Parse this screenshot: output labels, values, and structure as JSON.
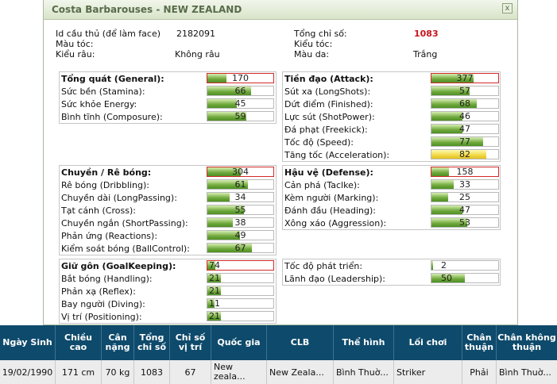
{
  "window": {
    "title": "Costa Barbarouses - NEW ZEALAND",
    "close_label": "x"
  },
  "info": {
    "id_label": "Id cầu thủ (để làm face)",
    "id_value": "2182091",
    "hair_color_label": "Màu tóc:",
    "beard_label": "Kiểu râu:",
    "beard_value": "Không râu",
    "total_label": "Tổng chỉ số:",
    "total_value": "1083",
    "hair_style_label": "Kiểu tóc:",
    "skin_label": "Màu da:",
    "skin_value": "Trắng"
  },
  "panels": {
    "general": {
      "header": "Tổng quát (General):",
      "header_value": 170,
      "items": [
        {
          "label": "Sức bền (Stamina):",
          "value": 66
        },
        {
          "label": "Sức khỏe Energy:",
          "value": 45
        },
        {
          "label": "Bình tĩnh (Composure):",
          "value": 59
        }
      ]
    },
    "attack": {
      "header": "Tiền đạo (Attack):",
      "header_value": 377,
      "items": [
        {
          "label": "Sút xa (LongShots):",
          "value": 57
        },
        {
          "label": "Dứt điểm (Finished):",
          "value": 68
        },
        {
          "label": "Lực sút (ShotPower):",
          "value": 46
        },
        {
          "label": "Đá phạt (Freekick):",
          "value": 47
        },
        {
          "label": "Tốc độ (Speed):",
          "value": 77
        },
        {
          "label": "Tăng tốc (Acceleration):",
          "value": 82,
          "yellow": true
        }
      ]
    },
    "dribbling": {
      "header": "Chuyền / Rê bóng:",
      "header_value": 304,
      "items": [
        {
          "label": "Rê bóng (Dribbling):",
          "value": 61
        },
        {
          "label": "Chuyền dài (LongPassing):",
          "value": 34
        },
        {
          "label": "Tạt cánh (Cross):",
          "value": 55
        },
        {
          "label": "Chuyền ngắn (ShortPassing):",
          "value": 38
        },
        {
          "label": "Phản ứng (Reactions):",
          "value": 49
        },
        {
          "label": "Kiểm soát bóng (BallControl):",
          "value": 67
        }
      ]
    },
    "defense": {
      "header": "Hậu vệ (Defense):",
      "header_value": 158,
      "items": [
        {
          "label": "Cản phá (Taclke):",
          "value": 33
        },
        {
          "label": "Kèm người (Marking):",
          "value": 25
        },
        {
          "label": "Đánh đầu (Heading):",
          "value": 47
        },
        {
          "label": "Xông xáo (Aggression):",
          "value": 53
        }
      ]
    },
    "goalkeeping": {
      "header": "Giữ gôn (GoalKeeping):",
      "header_value": 74,
      "items": [
        {
          "label": "Bắt bóng (Handling):",
          "value": 21
        },
        {
          "label": "Phản xạ (Reflex):",
          "value": 21
        },
        {
          "label": "Bay người (Diving):",
          "value": 11
        },
        {
          "label": "Vị trí (Positioning):",
          "value": 21
        }
      ]
    },
    "other": {
      "items": [
        {
          "label": "Tốc độ phát triển:",
          "value": 2
        },
        {
          "label": "Lãnh đạo (Leadership):",
          "value": 50
        }
      ]
    }
  },
  "table": {
    "headers": [
      "Ngày Sinh",
      "Chiều cao",
      "Cân nặng",
      "Tổng chỉ số",
      "Chỉ số vị trí",
      "Quốc gia",
      "CLB",
      "Thể hình",
      "Lối chơi",
      "Chân thuận",
      "Chân không thuận"
    ],
    "row": [
      "19/02/1990",
      "171 cm",
      "70 kg",
      "1083",
      "67",
      "New zeala...",
      "New Zeala...",
      "Bình Thuờ...",
      "Striker",
      "Phải",
      "Bình Thuờ..."
    ]
  },
  "colors": {
    "header_bg": "#0e4a6b",
    "title_text": "#586c4a",
    "total_value": "#c8141e"
  }
}
